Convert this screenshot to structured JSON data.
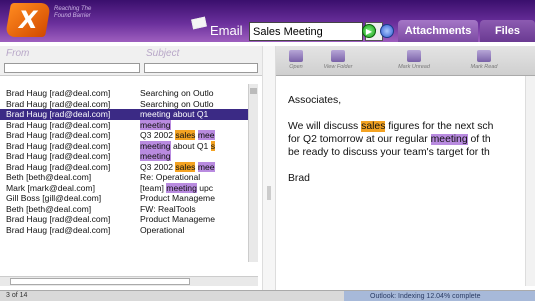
{
  "header": {
    "logo_letter": "X",
    "tagline_line1": "Reaching The",
    "tagline_line2": "Found Barrier",
    "search_category": "Email",
    "search_value": "Sales Meeting",
    "tabs": [
      {
        "label": "Attachments"
      },
      {
        "label": "Files"
      }
    ]
  },
  "list": {
    "columns": {
      "from": "From",
      "subject": "Subject"
    },
    "rows": [
      {
        "from": "Brad Haug [rad@deal.com]",
        "subject": [
          {
            "t": "Searching on Outlo",
            "h": ""
          }
        ],
        "selected": false
      },
      {
        "from": "Brad Haug [rad@deal.com]",
        "subject": [
          {
            "t": "Searching on Outlo",
            "h": ""
          }
        ],
        "selected": false
      },
      {
        "from": "Brad Haug [rad@deal.com]",
        "subject": [
          {
            "t": "meeting about Q1",
            "h": ""
          }
        ],
        "selected": true
      },
      {
        "from": "Brad Haug [rad@deal.com]",
        "subject": [
          {
            "t": "meeting",
            "h": "meeting"
          }
        ],
        "selected": false
      },
      {
        "from": "Brad Haug [rad@deal.com]",
        "subject": [
          {
            "t": "Q3 2002 ",
            "h": ""
          },
          {
            "t": "sales",
            "h": "sales"
          },
          {
            "t": " ",
            "h": ""
          },
          {
            "t": "mee",
            "h": "meeting"
          }
        ],
        "selected": false
      },
      {
        "from": "Brad Haug [rad@deal.com]",
        "subject": [
          {
            "t": "meeting",
            "h": "meeting"
          },
          {
            "t": " about Q1 ",
            "h": ""
          },
          {
            "t": "s",
            "h": "sales"
          }
        ],
        "selected": false
      },
      {
        "from": "Brad Haug [rad@deal.com]",
        "subject": [
          {
            "t": "meeting",
            "h": "meeting"
          }
        ],
        "selected": false
      },
      {
        "from": "Brad Haug [rad@deal.com]",
        "subject": [
          {
            "t": "Q3 2002 ",
            "h": ""
          },
          {
            "t": "sales",
            "h": "sales"
          },
          {
            "t": " ",
            "h": ""
          },
          {
            "t": "mee",
            "h": "meeting"
          }
        ],
        "selected": false
      },
      {
        "from": "Beth [beth@deal.com]",
        "subject": [
          {
            "t": "Re: Operational",
            "h": ""
          }
        ],
        "selected": false
      },
      {
        "from": "Mark [mark@deal.com]",
        "subject": [
          {
            "t": "[team] ",
            "h": ""
          },
          {
            "t": "meeting",
            "h": "meeting"
          },
          {
            "t": " upc",
            "h": ""
          }
        ],
        "selected": false
      },
      {
        "from": "Gill Boss [gill@deal.com]",
        "subject": [
          {
            "t": "Product Manageme",
            "h": ""
          }
        ],
        "selected": false
      },
      {
        "from": "Beth [beth@deal.com]",
        "subject": [
          {
            "t": "FW: RealTools",
            "h": ""
          }
        ],
        "selected": false
      },
      {
        "from": "Brad Haug [rad@deal.com]",
        "subject": [
          {
            "t": "Product Manageme",
            "h": ""
          }
        ],
        "selected": false
      },
      {
        "from": "Brad Haug [rad@deal.com]",
        "subject": [
          {
            "t": "Operational",
            "h": ""
          }
        ],
        "selected": false
      }
    ]
  },
  "toolbar": {
    "open": "Open",
    "view_folder": "View Folder",
    "mark_unread": "Mark Unread",
    "mark_read": "Mark Read"
  },
  "message": {
    "greeting": "Associates,",
    "body_lines": [
      [
        {
          "t": "We will discuss ",
          "h": ""
        },
        {
          "t": "sales",
          "h": "sales"
        },
        {
          "t": " figures for the next sch",
          "h": ""
        }
      ],
      [
        {
          "t": "for Q2 tomorrow at our regular ",
          "h": ""
        },
        {
          "t": "meeting",
          "h": "meeting"
        },
        {
          "t": " of th",
          "h": ""
        }
      ],
      [
        {
          "t": "be ready to discuss your team's target for th",
          "h": ""
        }
      ]
    ],
    "signature": "Brad"
  },
  "status": {
    "count": "3 of 14",
    "indexing": "Outlook: Indexing 12.04% complete"
  },
  "colors": {
    "sales_highlight": "#f4a322",
    "meeting_highlight": "#b98be0",
    "selected_row": "#3b2a85",
    "header_purple": "#6a2f9b"
  }
}
